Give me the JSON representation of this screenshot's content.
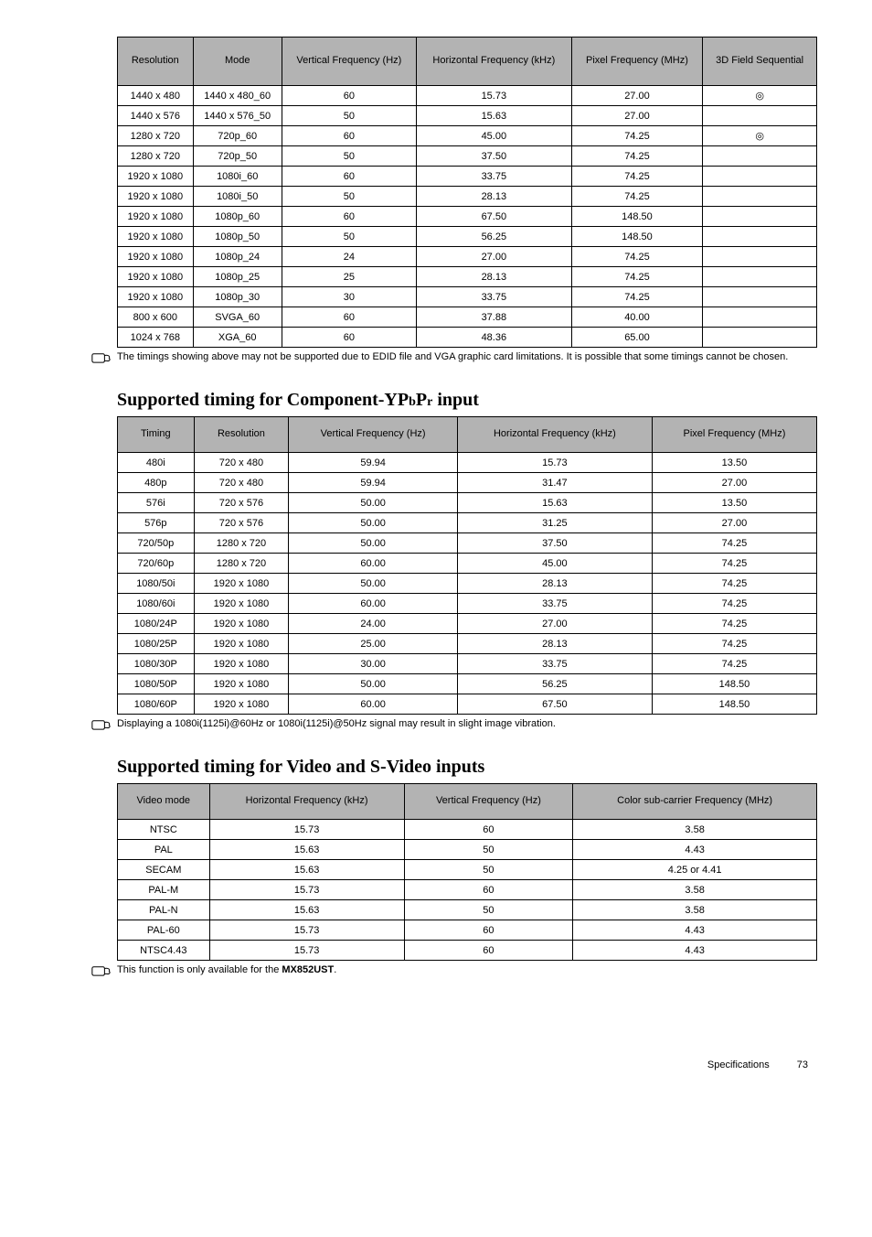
{
  "table1": {
    "headers": [
      "Resolution",
      "Mode",
      "Vertical Frequency (Hz)",
      "Horizontal Frequency (kHz)",
      "Pixel Frequency (MHz)",
      "3D Field Sequential"
    ],
    "rows": [
      [
        "1440 x 480",
        "1440 x 480_60",
        "60",
        "15.73",
        "27.00",
        "◎"
      ],
      [
        "1440 x 576",
        "1440 x 576_50",
        "50",
        "15.63",
        "27.00",
        ""
      ],
      [
        "1280 x 720",
        "720p_60",
        "60",
        "45.00",
        "74.25",
        "◎"
      ],
      [
        "1280 x 720",
        "720p_50",
        "50",
        "37.50",
        "74.25",
        ""
      ],
      [
        "1920 x 1080",
        "1080i_60",
        "60",
        "33.75",
        "74.25",
        ""
      ],
      [
        "1920 x 1080",
        "1080i_50",
        "50",
        "28.13",
        "74.25",
        ""
      ],
      [
        "1920 x 1080",
        "1080p_60",
        "60",
        "67.50",
        "148.50",
        ""
      ],
      [
        "1920 x 1080",
        "1080p_50",
        "50",
        "56.25",
        "148.50",
        ""
      ],
      [
        "1920 x 1080",
        "1080p_24",
        "24",
        "27.00",
        "74.25",
        ""
      ],
      [
        "1920 x 1080",
        "1080p_25",
        "25",
        "28.13",
        "74.25",
        ""
      ],
      [
        "1920 x 1080",
        "1080p_30",
        "30",
        "33.75",
        "74.25",
        ""
      ],
      [
        "800 x 600",
        "SVGA_60",
        "60",
        "37.88",
        "40.00",
        ""
      ],
      [
        "1024 x 768",
        "XGA_60",
        "60",
        "48.36",
        "65.00",
        ""
      ]
    ]
  },
  "note1": "The timings showing above may not be supported due to EDID file and VGA graphic card limitations. It is possible that some timings cannot be chosen.",
  "heading2_pre": "Supported timing for Component-YP",
  "heading2_b": "b",
  "heading2_mid": "P",
  "heading2_r": "r",
  "heading2_post": " input",
  "table2": {
    "headers": [
      "Timing",
      "Resolution",
      "Vertical Frequency (Hz)",
      "Horizontal Frequency (kHz)",
      "Pixel Frequency (MHz)"
    ],
    "rows": [
      [
        "480i",
        "720 x 480",
        "59.94",
        "15.73",
        "13.50"
      ],
      [
        "480p",
        "720 x 480",
        "59.94",
        "31.47",
        "27.00"
      ],
      [
        "576i",
        "720 x 576",
        "50.00",
        "15.63",
        "13.50"
      ],
      [
        "576p",
        "720 x 576",
        "50.00",
        "31.25",
        "27.00"
      ],
      [
        "720/50p",
        "1280 x 720",
        "50.00",
        "37.50",
        "74.25"
      ],
      [
        "720/60p",
        "1280 x 720",
        "60.00",
        "45.00",
        "74.25"
      ],
      [
        "1080/50i",
        "1920 x 1080",
        "50.00",
        "28.13",
        "74.25"
      ],
      [
        "1080/60i",
        "1920 x 1080",
        "60.00",
        "33.75",
        "74.25"
      ],
      [
        "1080/24P",
        "1920 x 1080",
        "24.00",
        "27.00",
        "74.25"
      ],
      [
        "1080/25P",
        "1920 x 1080",
        "25.00",
        "28.13",
        "74.25"
      ],
      [
        "1080/30P",
        "1920 x 1080",
        "30.00",
        "33.75",
        "74.25"
      ],
      [
        "1080/50P",
        "1920 x 1080",
        "50.00",
        "56.25",
        "148.50"
      ],
      [
        "1080/60P",
        "1920 x 1080",
        "60.00",
        "67.50",
        "148.50"
      ]
    ]
  },
  "note2": "Displaying a 1080i(1125i)@60Hz or 1080i(1125i)@50Hz signal may result in slight image vibration.",
  "heading3": "Supported timing for Video and S-Video inputs",
  "table3": {
    "headers": [
      "Video mode",
      "Horizontal Frequency (kHz)",
      "Vertical Frequency (Hz)",
      "Color sub-carrier Frequency (MHz)"
    ],
    "rows": [
      [
        "NTSC",
        "15.73",
        "60",
        "3.58"
      ],
      [
        "PAL",
        "15.63",
        "50",
        "4.43"
      ],
      [
        "SECAM",
        "15.63",
        "50",
        "4.25 or 4.41"
      ],
      [
        "PAL-M",
        "15.73",
        "60",
        "3.58"
      ],
      [
        "PAL-N",
        "15.63",
        "50",
        "3.58"
      ],
      [
        "PAL-60",
        "15.73",
        "60",
        "4.43"
      ],
      [
        "NTSC4.43",
        "15.73",
        "60",
        "4.43"
      ]
    ]
  },
  "note3_pre": "This function is only available for the ",
  "note3_bold": "MX852UST",
  "note3_post": ".",
  "footer_section": "Specifications",
  "footer_page": "73"
}
